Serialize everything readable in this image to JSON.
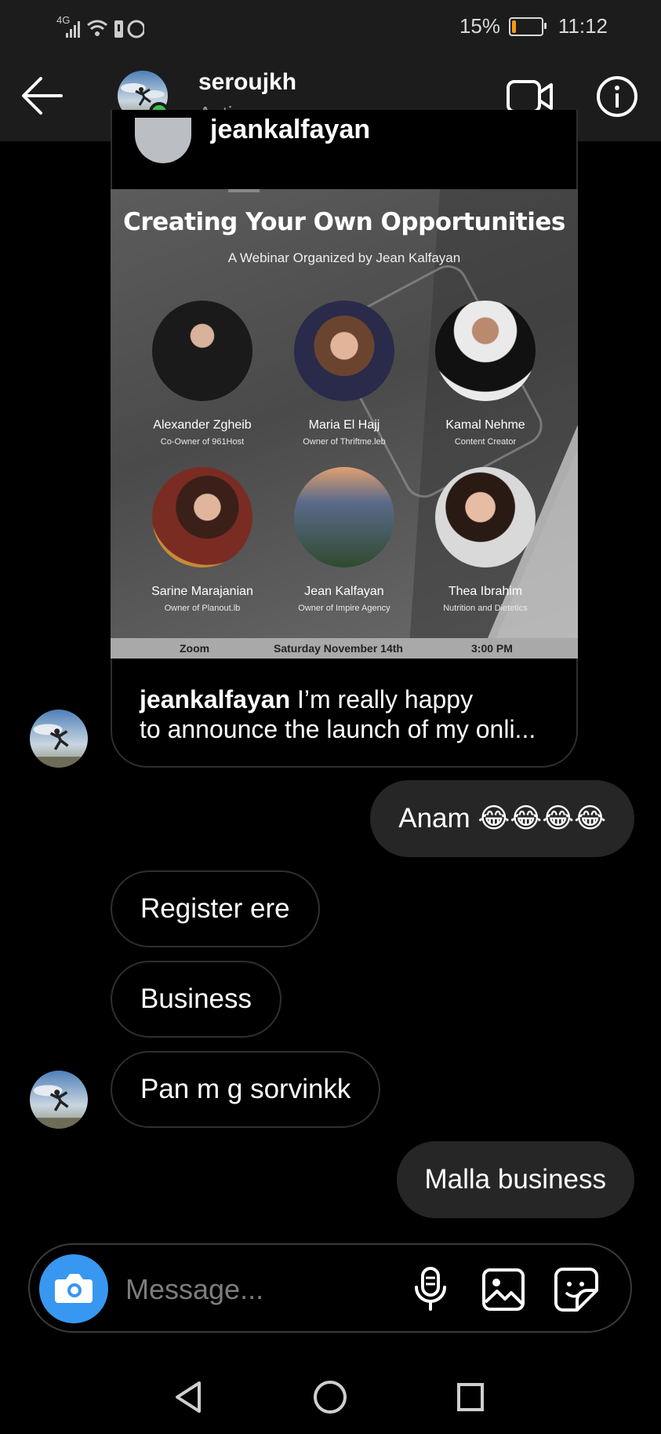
{
  "status_bar": {
    "network": "4G",
    "battery_pct": "15%",
    "battery_level": 0.15,
    "time": "11:12"
  },
  "header": {
    "username": "seroujkh",
    "status": "Active now"
  },
  "post": {
    "author": "jeankalfayan",
    "poster": {
      "title": "Creating Your Own Opportunities",
      "subtitle": "A Webinar Organized by Jean Kalfayan",
      "speakers": [
        {
          "name": "Alexander Zgheib",
          "role": "Co-Owner of 961Host"
        },
        {
          "name": "Maria El Hajj",
          "role": "Owner of Thriftme.leb"
        },
        {
          "name": "Kamal Nehme",
          "role": "Content Creator"
        },
        {
          "name": "Sarine Marajanian",
          "role": "Owner of Planout.lb"
        },
        {
          "name": "Jean Kalfayan",
          "role": "Owner of Impire Agency"
        },
        {
          "name": "Thea Ibrahim",
          "role": "Nutrition and Dietetics"
        }
      ],
      "footer": {
        "platform": "Zoom",
        "date": "Saturday November 14th",
        "time": "3:00 PM"
      }
    },
    "caption_author": "jeankalfayan",
    "caption_line1": "I’m really happy",
    "caption_line2": "to announce the launch of my onli..."
  },
  "messages": [
    {
      "side": "out",
      "text": "Anam 😂😂😂😂"
    },
    {
      "side": "in",
      "text": "Register ere"
    },
    {
      "side": "in",
      "text": "Business"
    },
    {
      "side": "in",
      "text": "Pan m g sorvinkk"
    },
    {
      "side": "out",
      "text": "Malla business"
    }
  ],
  "composer": {
    "placeholder": "Message..."
  },
  "icons": {
    "back": "arrow-left-icon",
    "video": "video-camera-icon",
    "info": "info-icon",
    "camera": "camera-icon",
    "mic": "microphone-icon",
    "gallery": "image-icon",
    "sticker": "sticker-icon"
  },
  "colors": {
    "accent": "#3897f0",
    "online": "#3ec14f",
    "bubble_out": "#262626",
    "battery_low": "#f39c12"
  }
}
